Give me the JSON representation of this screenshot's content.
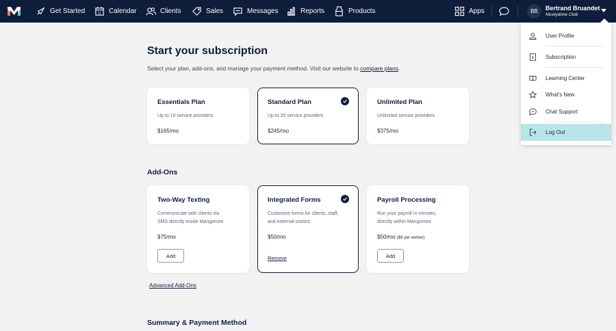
{
  "nav": {
    "items": [
      {
        "label": "Get Started"
      },
      {
        "label": "Calendar"
      },
      {
        "label": "Clients"
      },
      {
        "label": "Sales"
      },
      {
        "label": "Messages"
      },
      {
        "label": "Reports"
      },
      {
        "label": "Products"
      }
    ],
    "apps_label": "Apps",
    "user": {
      "initials": "BB",
      "name": "Bertrand Bruandet",
      "org": "Nicelydone Club"
    }
  },
  "page": {
    "title": "Start your subscription",
    "desc_prefix": "Select your plan, add-ons, and manage your payment method. Visit our website to ",
    "desc_link": "compare plans",
    "desc_suffix": "."
  },
  "plans": [
    {
      "title": "Essentials Plan",
      "sub": "Up to 10 service providers",
      "price": "$165/mo",
      "selected": false
    },
    {
      "title": "Standard Plan",
      "sub": "Up to 20 service providers",
      "price": "$245/mo",
      "selected": true
    },
    {
      "title": "Unlimited Plan",
      "sub": "Unlimited service providers",
      "price": "$375/mo",
      "selected": false
    }
  ],
  "addons_title": "Add-Ons",
  "addons": [
    {
      "title": "Two-Way Texting",
      "sub1": "Communicate with clients via",
      "sub2": "SMS directly inside Mangomint",
      "price": "$75/mo",
      "price_note": "",
      "action": "Add",
      "selected": false
    },
    {
      "title": "Integrated Forms",
      "sub1": "Customize forms for clients, staff,",
      "sub2": "and external visitors",
      "price": "$50/mo",
      "price_note": "",
      "action": "Remove",
      "selected": true
    },
    {
      "title": "Payroll Processing",
      "sub1": "Run your payroll in minutes,",
      "sub2": "directly within Mangomint",
      "price": "$50/mo",
      "price_note": "($8 per worker)",
      "action": "Add",
      "selected": false
    }
  ],
  "advanced_link": "Advanced Add-Ons",
  "summary_title": "Summary & Payment Method",
  "dropdown": {
    "items": [
      {
        "label": "User Profile",
        "icon": "user-icon"
      },
      {
        "label": "Subscription",
        "icon": "receipt-icon"
      },
      {
        "label": "Learning Center",
        "icon": "book-icon"
      },
      {
        "label": "What's New",
        "icon": "star-icon"
      },
      {
        "label": "Chat Support",
        "icon": "chat-icon"
      },
      {
        "label": "Log Out",
        "icon": "logout-icon"
      }
    ],
    "active_color": "#b8e5e9"
  },
  "colors": {
    "nav_bg": "#0e1d3a",
    "page_bg": "#f2f2f3",
    "accent": "#0e1d3a"
  }
}
